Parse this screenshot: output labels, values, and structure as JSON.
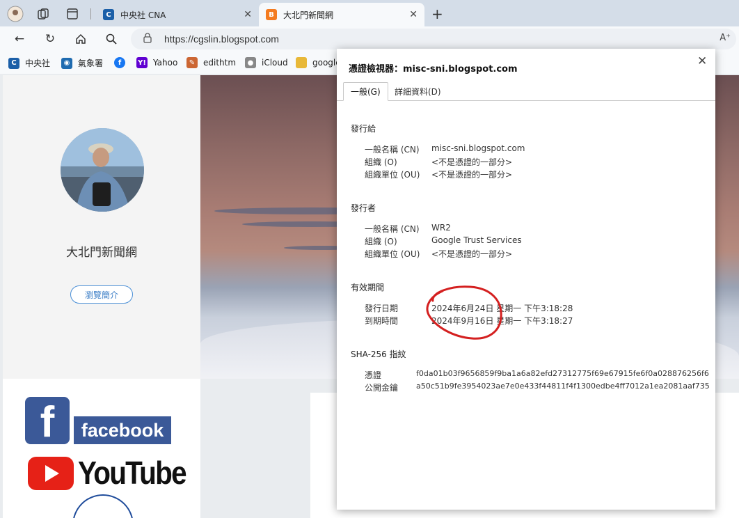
{
  "browser": {
    "tabs": [
      {
        "label": "中央社 CNA",
        "favicon_color": "#1b5fa8"
      },
      {
        "label": "大北門新聞網",
        "favicon_color": "#f47b20"
      }
    ],
    "url": "https://cgslin.blogspot.com",
    "reader_mode": "A⁺",
    "bookmarks": [
      {
        "label": "中央社",
        "color": "#1b5fa8"
      },
      {
        "label": "氣象署",
        "color": "#1f6bb0"
      },
      {
        "label": "",
        "color": "#1877f2"
      },
      {
        "label": "Yahoo",
        "color": "#6001d2"
      },
      {
        "label": "edithtm",
        "color": "#cc6633"
      },
      {
        "label": "iCloud",
        "color": "#888888"
      },
      {
        "label": "google",
        "color": "#e8b838"
      }
    ]
  },
  "page": {
    "blog_title": "大北門新聞網",
    "profile_button": "瀏覽簡介",
    "facebook_logo": "facebook",
    "facebook_f": "f",
    "youtube_logo": "YouTube"
  },
  "dialog": {
    "title": "憑證檢視器：misc-sni.blogspot.com",
    "tabs": [
      "一般(G)",
      "詳細資料(D)"
    ],
    "issued_to": {
      "heading": "發行給",
      "rows": [
        {
          "label": "一般名稱 (CN)",
          "value": "misc-sni.blogspot.com"
        },
        {
          "label": "組織 (O)",
          "value": "<不是憑證的一部分>"
        },
        {
          "label": "組織單位 (OU)",
          "value": "<不是憑證的一部分>"
        }
      ]
    },
    "issued_by": {
      "heading": "發行者",
      "rows": [
        {
          "label": "一般名稱 (CN)",
          "value": "WR2"
        },
        {
          "label": "組織 (O)",
          "value": "Google Trust Services"
        },
        {
          "label": "組織單位 (OU)",
          "value": "<不是憑證的一部分>"
        }
      ]
    },
    "validity": {
      "heading": "有效期間",
      "rows": [
        {
          "label": "發行日期",
          "value": "2024年6月24日 星期一 下午3:18:28"
        },
        {
          "label": "到期時間",
          "value": "2024年9月16日 星期一 下午3:18:27"
        }
      ]
    },
    "fingerprints": {
      "heading": "SHA-256 指紋",
      "rows": [
        {
          "label": "憑證",
          "value": "f0da01b03f9656859f9ba1a6a82efd27312775f69e67915fe6f0a028876256f6"
        },
        {
          "label": "公開金鑰",
          "value": "a50c51b9fe3954023ae7e0e433f44811f4f1300edbe4ff7012a1ea2081aaf735"
        }
      ]
    }
  },
  "colors": {
    "annotation": "#d42020",
    "accent": "#4a8fd6"
  }
}
